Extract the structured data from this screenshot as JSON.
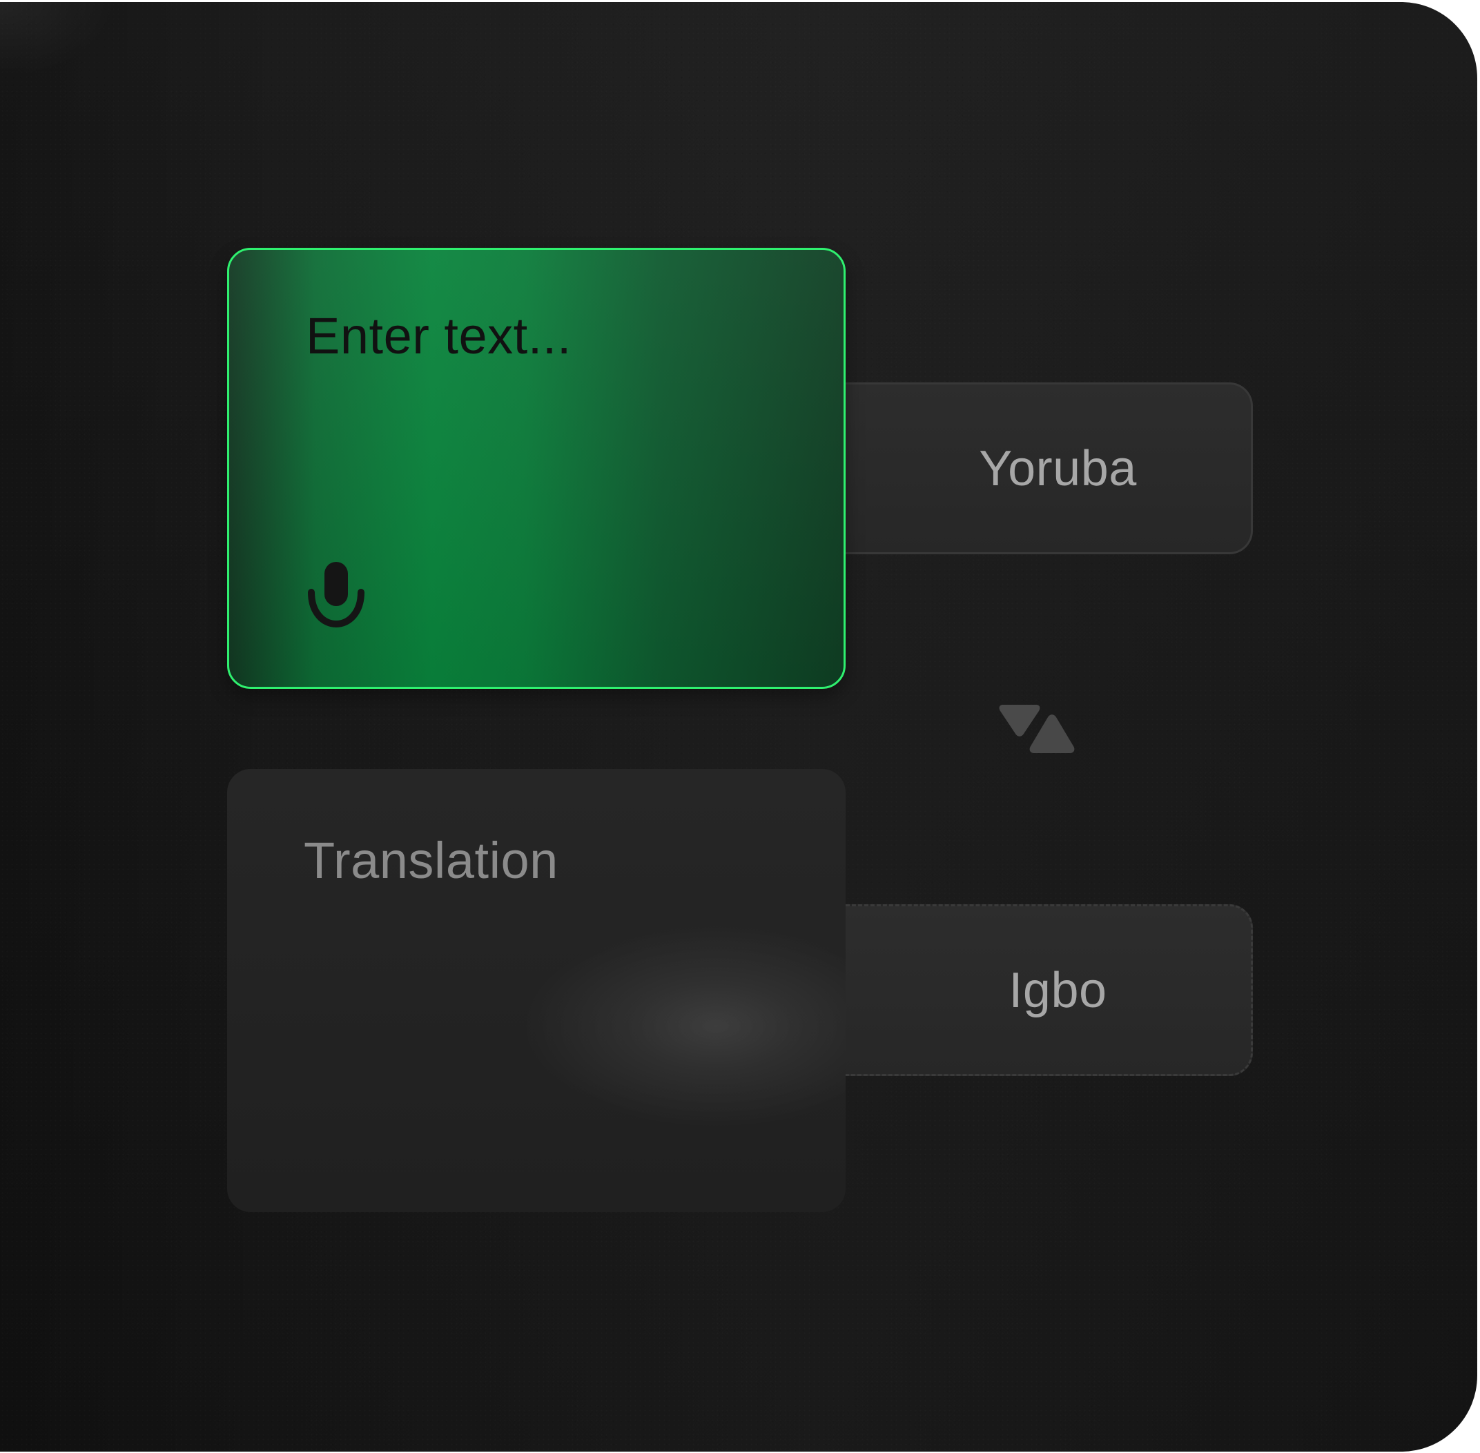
{
  "translator": {
    "source_placeholder": "Enter text...",
    "target_placeholder": "Translation",
    "source_language": "Yoruba",
    "target_language": "Igbo"
  },
  "icons": {
    "microphone": "microphone-icon",
    "swap": "swap-languages-icon"
  },
  "colors": {
    "accent_border": "#2ff06f",
    "source_box_green": "#09843c",
    "background_dark": "#191919",
    "muted_text": "#8b8b8b",
    "language_text": "#a7a7a7"
  }
}
